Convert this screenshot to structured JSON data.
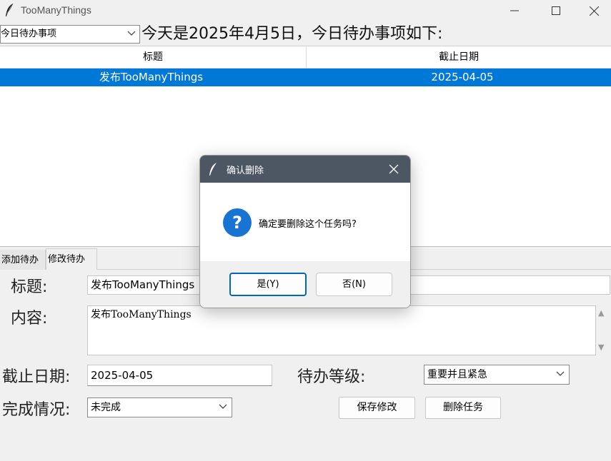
{
  "window": {
    "title": "TooManyThings",
    "icon": "feather-icon"
  },
  "view_select": {
    "value": "今日待办事项"
  },
  "date_banner": "今天是2025年4月5日，今日待办事项如下:",
  "table": {
    "headers": [
      "标题",
      "截止日期"
    ],
    "rows": [
      {
        "title": "发布TooManyThings",
        "deadline": "2025-04-05",
        "selected": true
      }
    ]
  },
  "tabs": [
    {
      "label": "添加待办"
    },
    {
      "label": "修改待办",
      "active": true
    }
  ],
  "form": {
    "title_label": "标题:",
    "title_value": "发布TooManyThings",
    "content_label": "内容:",
    "content_value": "发布TooManyThings",
    "deadline_label": "截止日期:",
    "deadline_value": "2025-04-05",
    "priority_label": "待办等级:",
    "priority_value": "重要并且紧急",
    "status_label": "完成情况:",
    "status_value": "未完成",
    "save_label": "保存修改",
    "delete_label": "删除任务"
  },
  "dialog": {
    "title": "确认删除",
    "message": "确定要删除这个任务吗?",
    "icon": "question-icon",
    "yes_label": "是(Y)",
    "no_label": "否(N)"
  },
  "colors": {
    "selection": "#0078d7",
    "dialog_titlebar": "#4d5663",
    "question_icon": "#1874d3"
  }
}
